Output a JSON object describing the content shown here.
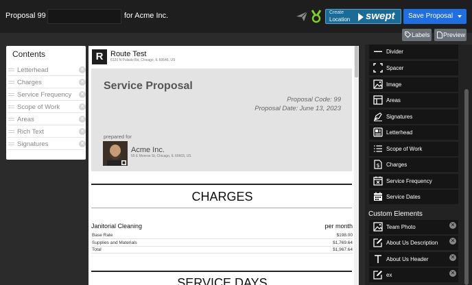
{
  "header": {
    "title_prefix": "Proposal 99 -",
    "proposal_name_value": "",
    "title_suffix": "for Acme Inc.",
    "swept_create": "Create",
    "swept_location": "Location",
    "swept_brand": "swept",
    "save_label": "Save Proposal",
    "labels_btn": "Labels",
    "preview_btn": "Preview"
  },
  "contents": {
    "title": "Contents",
    "items": [
      "Letterhead",
      "Charges",
      "Service Frequency",
      "Scope of Work",
      "Areas",
      "Rich Text",
      "Signatures"
    ]
  },
  "document": {
    "letterhead": {
      "logo_letter": "R",
      "company": "Route Test",
      "address": "6120 N Pulaski Rd, Chicago, IL 60646, US"
    },
    "cover": {
      "title": "Service Proposal",
      "code": "Proposal Code: 99",
      "date": "Proposal Date: June 13, 2023",
      "prepared_for": "prepared for",
      "client_name": "Acme Inc.",
      "client_address": "55 E Monroe St, Chicago, IL 60603, US"
    },
    "charges": {
      "heading": "CHARGES",
      "service": "Janitorial Cleaning",
      "period": "per month",
      "lines": [
        {
          "label": "Base Rate",
          "amount": "$198.00"
        },
        {
          "label": "Supplies and Materials",
          "amount": "$1,769.64"
        },
        {
          "label": "Total",
          "amount": "$1,967.64"
        }
      ]
    },
    "next_heading": "SERVICE DAYS"
  },
  "elements": {
    "items": [
      {
        "label": "Divider",
        "icon": "divider-icon"
      },
      {
        "label": "Spacer",
        "icon": "spacer-icon"
      },
      {
        "label": "Image",
        "icon": "image-icon"
      },
      {
        "label": "Areas",
        "icon": "areas-icon"
      },
      {
        "label": "Signatures",
        "icon": "signature-icon"
      },
      {
        "label": "Letterhead",
        "icon": "letterhead-icon"
      },
      {
        "label": "Scope of Work",
        "icon": "list-icon"
      },
      {
        "label": "Charges",
        "icon": "dollar-icon"
      },
      {
        "label": "Service Frequency",
        "icon": "calendar-x-icon"
      },
      {
        "label": "Service Dates",
        "icon": "calendar-icon"
      }
    ],
    "custom_heading": "Custom Elements",
    "custom_items": [
      {
        "label": "Team Photo",
        "icon": "image-icon"
      },
      {
        "label": "About Us Description",
        "icon": "edit-icon"
      },
      {
        "label": "About Us Header",
        "icon": "text-icon"
      },
      {
        "label": "ex",
        "icon": "edit-icon"
      }
    ]
  },
  "colors": {
    "primary": "#1f6fe0",
    "swept": "#1a6b96",
    "accent_green": "#7ed321"
  }
}
